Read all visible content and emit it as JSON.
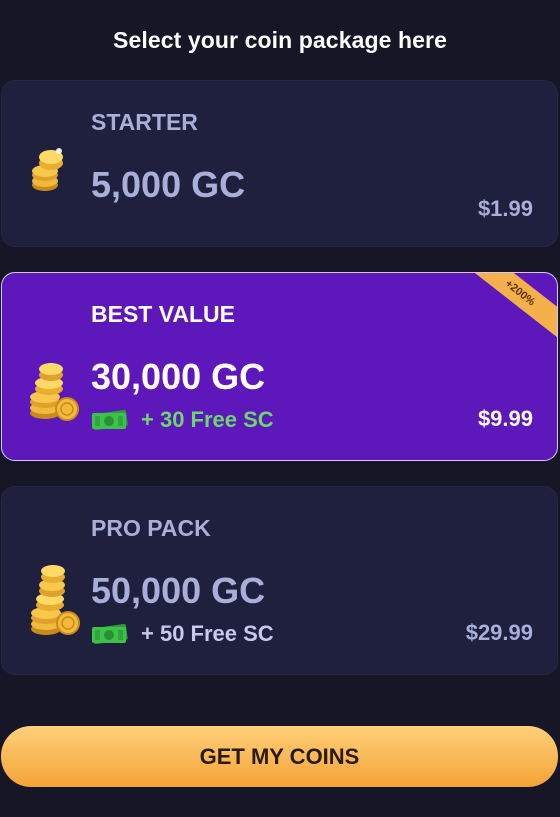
{
  "header": {
    "title": "Select your coin package here"
  },
  "packages": [
    {
      "name": "STARTER",
      "coins": "5,000 GC",
      "bonus": "",
      "price": "$1.99",
      "icon": "coin-stack-small-icon"
    },
    {
      "name": "BEST VALUE",
      "coins": "30,000 GC",
      "bonus": "+ 30 Free SC",
      "price": "$9.99",
      "badge": "+200%",
      "icon": "coin-stack-medium-icon"
    },
    {
      "name": "PRO PACK",
      "coins": "50,000 GC",
      "bonus": "+ 50 Free SC",
      "price": "$29.99",
      "icon": "coin-stack-large-icon"
    }
  ],
  "cta": {
    "label": "GET MY COINS"
  },
  "colors": {
    "background": "#161627",
    "card": "#1f1f3e",
    "highlight_card": "#5d17ba",
    "accent_green": "#6bd86b",
    "cta_gold": "#f4b04a"
  }
}
